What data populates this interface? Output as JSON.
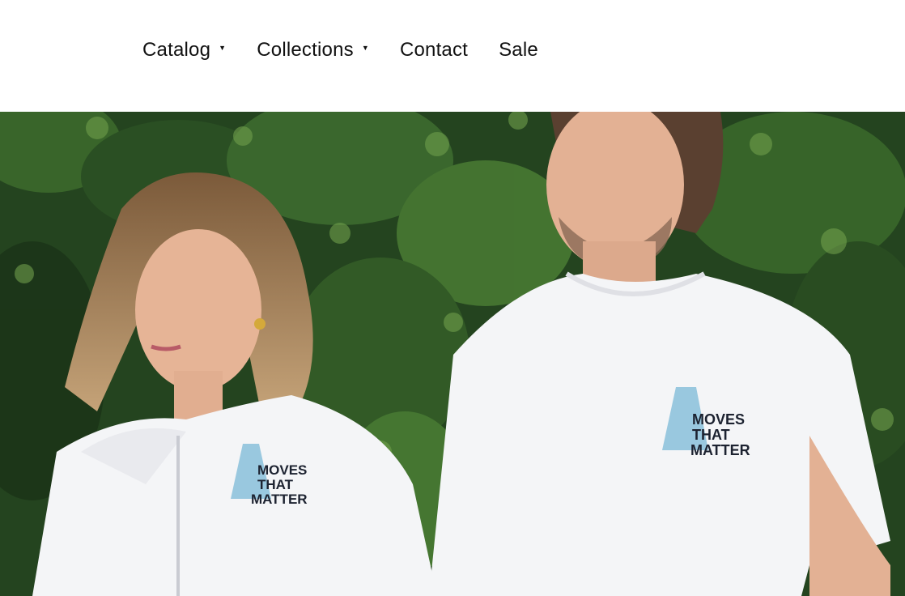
{
  "nav": {
    "items": [
      {
        "label": "Catalog",
        "has_dropdown": true
      },
      {
        "label": "Collections",
        "has_dropdown": true
      },
      {
        "label": "Contact",
        "has_dropdown": false
      },
      {
        "label": "Sale",
        "has_dropdown": false
      }
    ],
    "dropdown_glyph": "▾"
  },
  "hero": {
    "shirt_print_lines": [
      "MOVES",
      "THAT",
      "MATTER"
    ],
    "colors": {
      "foliage": "#2f5a2a",
      "shirt": "#f4f5f7",
      "print_text": "#1c2230",
      "print_icon": "#8fc3dc"
    }
  }
}
